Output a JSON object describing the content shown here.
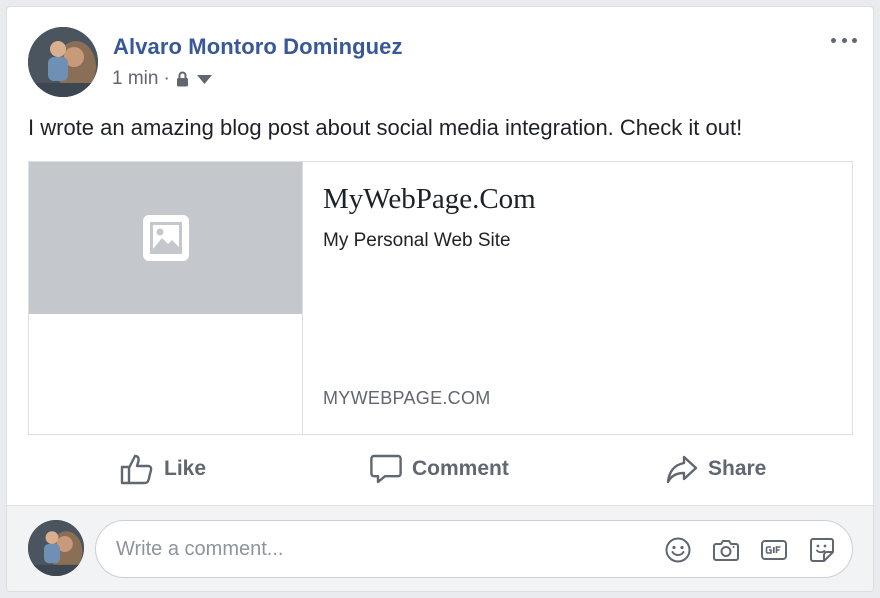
{
  "post": {
    "author": "Alvaro Montoro Dominguez",
    "timestamp": "1 min",
    "separator": "·",
    "privacy_icon": "lock-icon",
    "audience_icon": "caret-down-icon",
    "more_icon": "more-options-icon",
    "text": "I wrote an amazing blog post about social media integration. Check it out!"
  },
  "link_preview": {
    "image_icon": "image-placeholder-icon",
    "title": "MyWebPage.Com",
    "description": "My Personal Web Site",
    "domain": "MYWEBPAGE.COM"
  },
  "actions": {
    "like_label": "Like",
    "comment_label": "Comment",
    "share_label": "Share"
  },
  "comment_composer": {
    "placeholder": "Write a comment...",
    "value": "",
    "icons": [
      "emoji-icon",
      "camera-icon",
      "gif-icon",
      "sticker-icon"
    ]
  },
  "colors": {
    "author_link": "#385898",
    "secondary_text": "#606770",
    "placeholder_bg": "#c4c7cc",
    "footer_bg": "#f2f3f5"
  }
}
